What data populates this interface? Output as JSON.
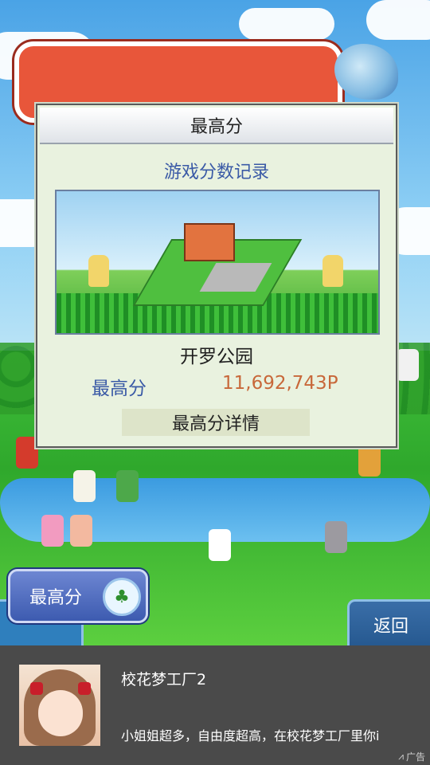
{
  "dialog": {
    "title": "最高分",
    "subtitle": "游戏分数记录",
    "park_name": "开罗公园",
    "score_label": "最高分",
    "score_value": "11,692,743P",
    "detail_button": "最高分详情"
  },
  "bottom_left_button": {
    "label": "最高分",
    "icon": "tree-icon"
  },
  "back_button": {
    "label": "返回"
  },
  "ad": {
    "title": "校花梦工厂2",
    "description": "小姐姐超多，自由度超高，在校花梦工厂里你i",
    "badge": "广告"
  }
}
